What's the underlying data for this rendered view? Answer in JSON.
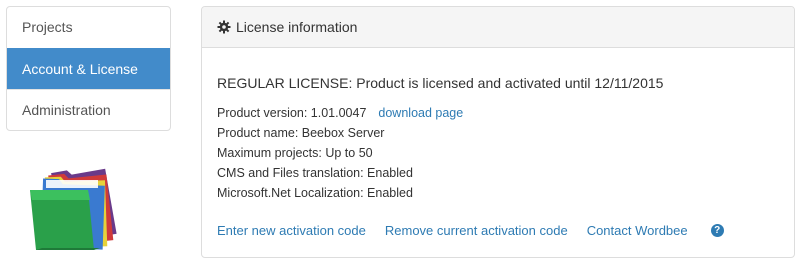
{
  "sidebar": {
    "items": [
      {
        "label": "Projects",
        "active": false
      },
      {
        "label": "Account & License",
        "active": true
      },
      {
        "label": "Administration",
        "active": false
      }
    ]
  },
  "illustration": {
    "icon": "folders-icon"
  },
  "panel": {
    "icon": "gear-icon",
    "title": "License information",
    "license_status": "REGULAR LICENSE: Product is licensed and activated until 12/11/2015",
    "product_version": "Product version: 1.01.0047",
    "download_link": "download page",
    "product_name": "Product name: Beebox Server",
    "max_projects": "Maximum projects: Up to 50",
    "cms_translation": "CMS and Files translation: Enabled",
    "net_localization": "Microsoft.Net Localization: Enabled",
    "actions": {
      "enter_code": "Enter new activation code",
      "remove_code": "Remove current activation code",
      "contact": "Contact Wordbee",
      "help_icon": "?"
    }
  },
  "colors": {
    "accent": "#428bca",
    "link": "#2e7bb3",
    "heading_bg": "#f5f5f5",
    "border": "#dddddd"
  }
}
